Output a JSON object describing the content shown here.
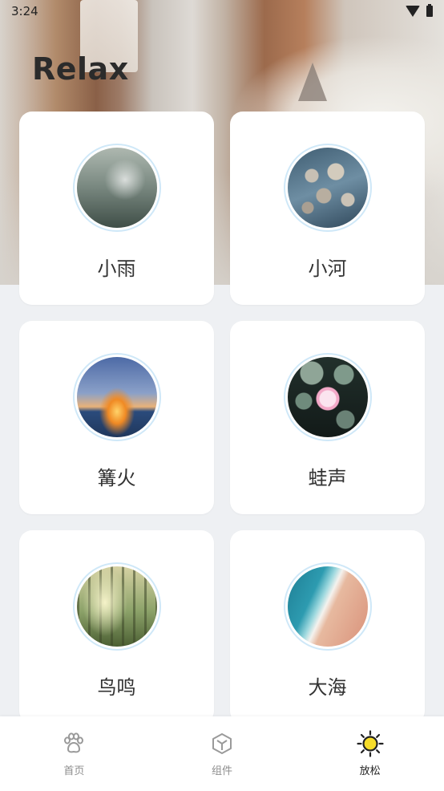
{
  "status_bar": {
    "time": "3:24"
  },
  "page_title": "Relax",
  "sounds": [
    {
      "label": "小雨",
      "thumb": "rain"
    },
    {
      "label": "小河",
      "thumb": "river"
    },
    {
      "label": "篝火",
      "thumb": "fire"
    },
    {
      "label": "蛙声",
      "thumb": "frog"
    },
    {
      "label": "鸟鸣",
      "thumb": "bird"
    },
    {
      "label": "大海",
      "thumb": "sea"
    }
  ],
  "bottom_nav": {
    "items": [
      {
        "label": "首页",
        "icon": "paw-icon"
      },
      {
        "label": "组件",
        "icon": "cube-icon"
      },
      {
        "label": "放松",
        "icon": "sun-icon",
        "active": true
      }
    ]
  },
  "colors": {
    "accent": "#f7dd2a",
    "card_ring": "#cfe8f8",
    "background": "#eef0f3"
  }
}
